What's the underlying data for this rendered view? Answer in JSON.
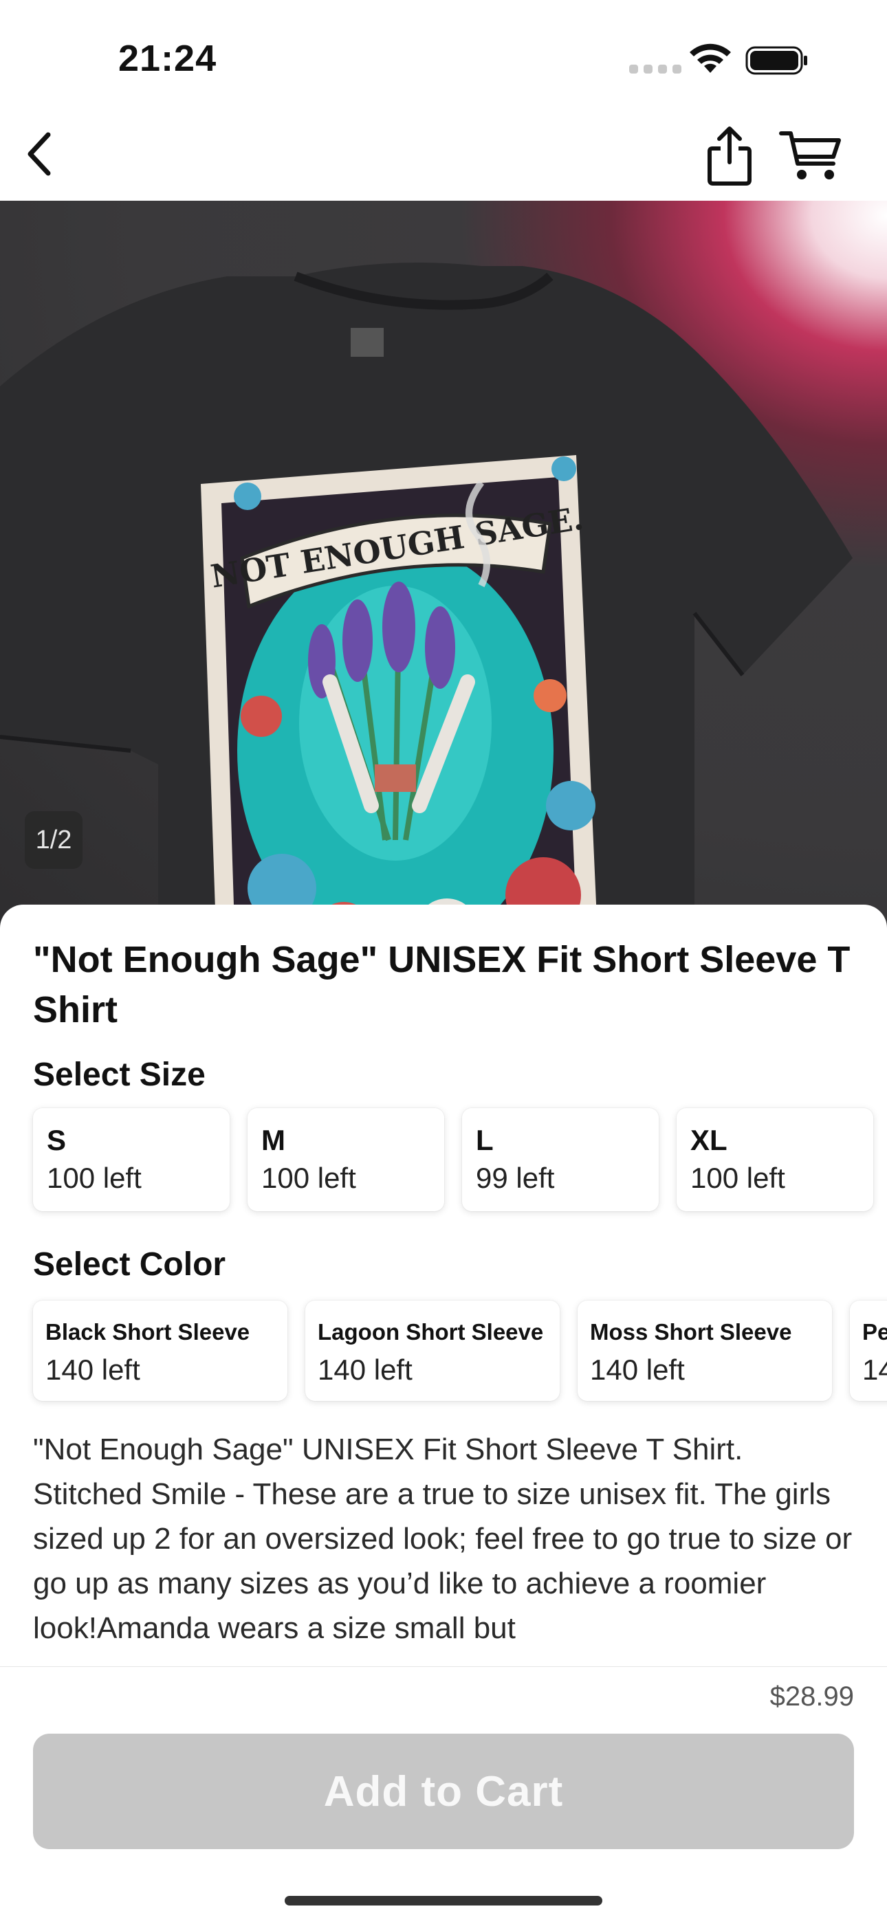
{
  "status_bar": {
    "time": "21:24"
  },
  "hero": {
    "image_counter": "1/2",
    "print_text": "NOT ENOUGH SAGE."
  },
  "product": {
    "title": "\"Not Enough Sage\" UNISEX Fit Short Sleeve T Shirt",
    "price": "$28.99",
    "description": "\"Not Enough Sage\" UNISEX Fit Short Sleeve T Shirt. Stitched Smile - These are a true to size unisex fit. The girls sized up 2 for an oversized look; feel free to go true to size or go up as many sizes as you’d like to achieve a roomier look!Amanda wears a size small but"
  },
  "size_section": {
    "label": "Select Size",
    "options": [
      {
        "name": "S",
        "stock": "100 left"
      },
      {
        "name": "M",
        "stock": "100 left"
      },
      {
        "name": "L",
        "stock": "99 left"
      },
      {
        "name": "XL",
        "stock": "100 left"
      }
    ]
  },
  "color_section": {
    "label": "Select Color",
    "options": [
      {
        "name": "Black Short Sleeve",
        "stock": "140 left"
      },
      {
        "name": "Lagoon Short Sleeve",
        "stock": "140 left"
      },
      {
        "name": "Moss Short Sleeve",
        "stock": "140 left"
      },
      {
        "name": "Pe",
        "stock": "14"
      }
    ]
  },
  "cart_button": {
    "label": "Add to Cart"
  },
  "colors": {
    "button_disabled": "#c6c6c6",
    "hero_bg": "#3a393b",
    "tshirt": "#2b2b2d",
    "print_teal": "#1fb5b3"
  }
}
